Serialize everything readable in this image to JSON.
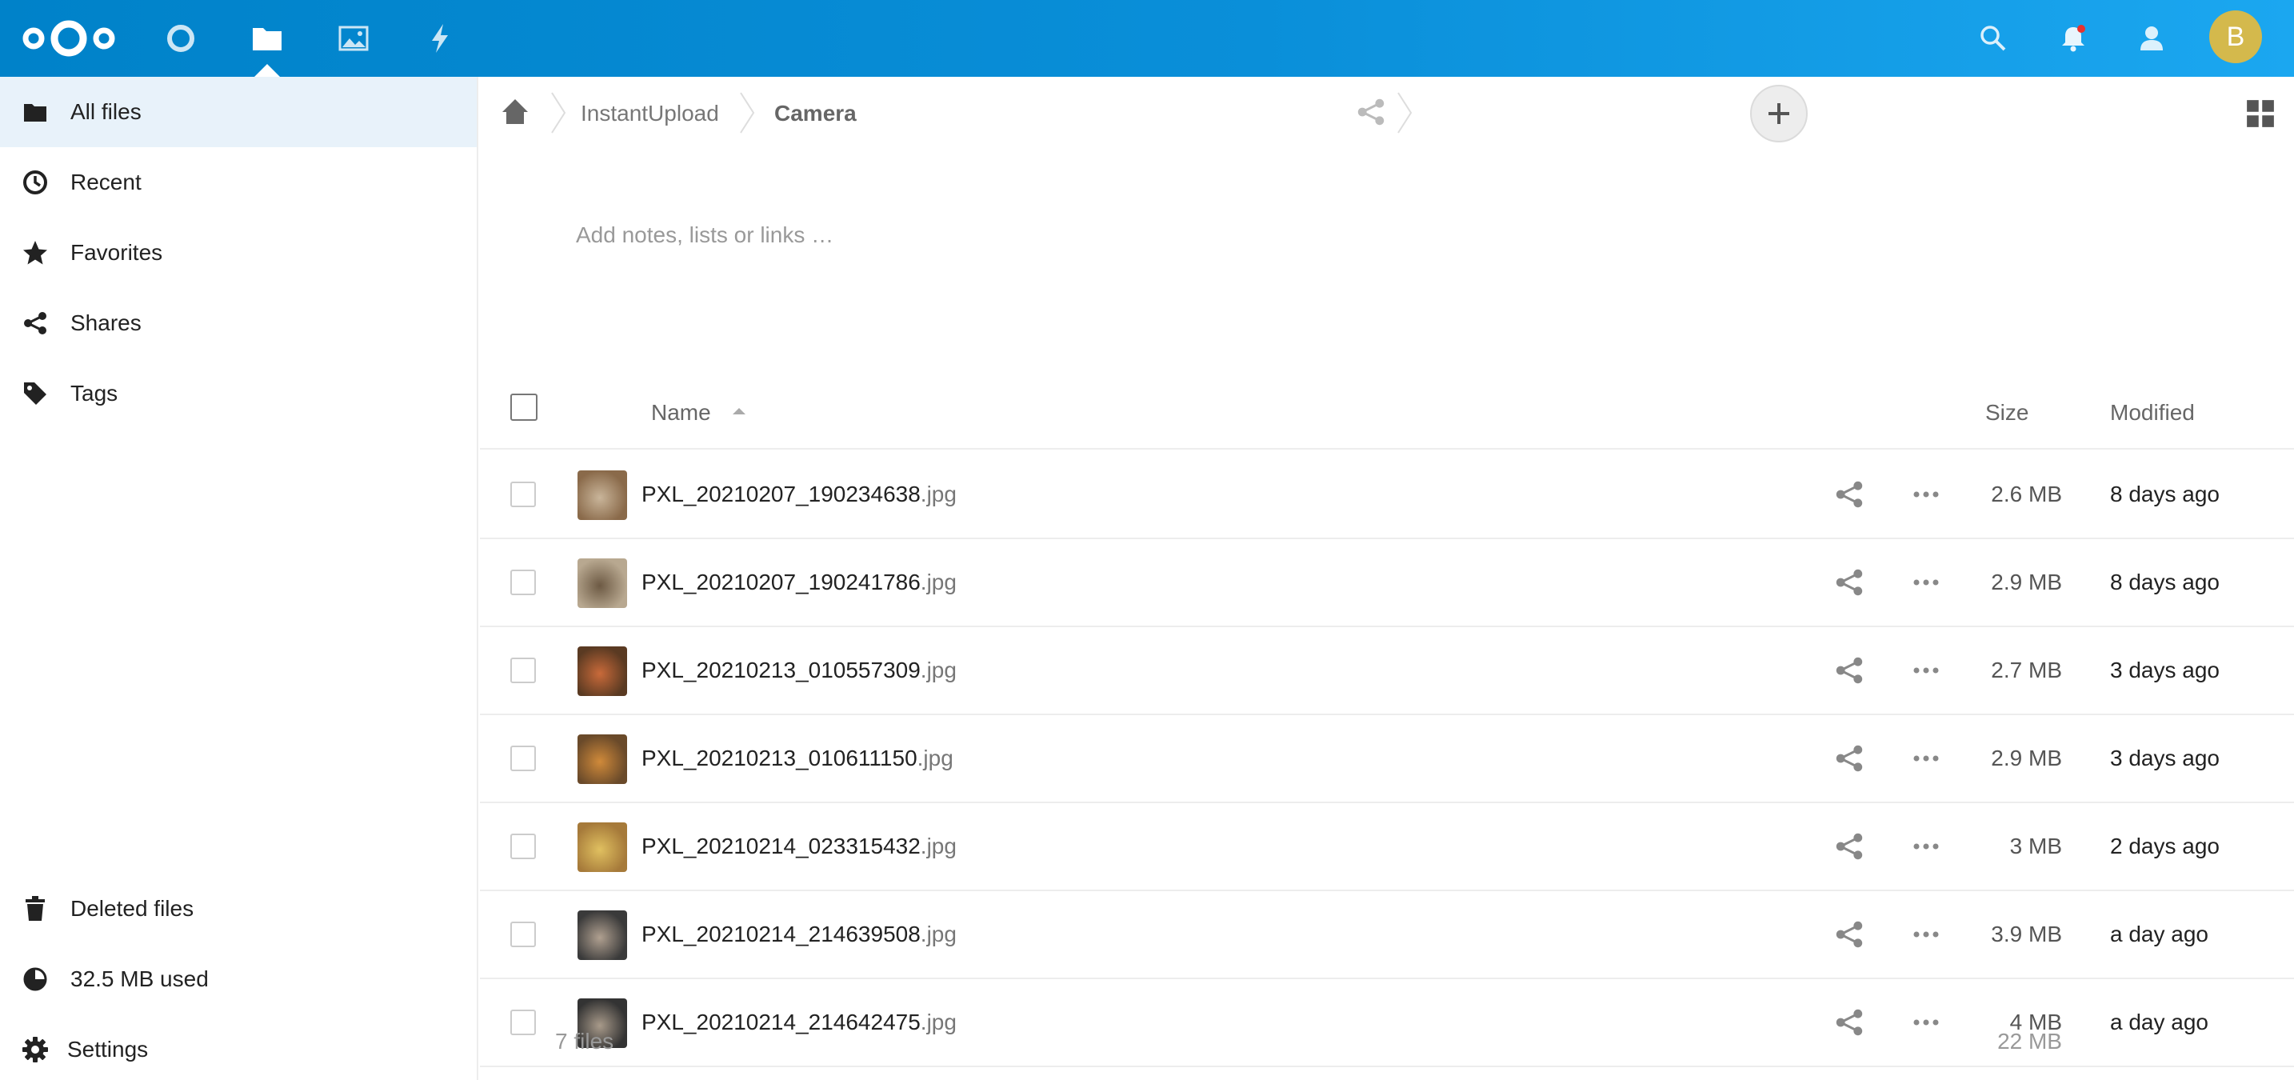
{
  "header": {
    "apps": [
      "dashboard",
      "files",
      "photos",
      "activity"
    ],
    "avatar_letter": "B"
  },
  "sidebar": {
    "items": [
      {
        "label": "All files",
        "icon": "folder-icon"
      },
      {
        "label": "Recent",
        "icon": "clock-icon"
      },
      {
        "label": "Favorites",
        "icon": "star-icon"
      },
      {
        "label": "Shares",
        "icon": "share-icon"
      },
      {
        "label": "Tags",
        "icon": "tag-icon"
      }
    ],
    "bottom": {
      "deleted": "Deleted files",
      "quota": "32.5 MB used",
      "settings": "Settings"
    }
  },
  "breadcrumb": {
    "items": [
      "InstantUpload",
      "Camera"
    ]
  },
  "notes_placeholder": "Add notes, lists or links …",
  "list": {
    "columns": {
      "name": "Name",
      "size": "Size",
      "modified": "Modified"
    },
    "files": [
      {
        "base": "PXL_20210207_190234638",
        "ext": ".jpg",
        "size": "2.6 MB",
        "modified": "8 days ago"
      },
      {
        "base": "PXL_20210207_190241786",
        "ext": ".jpg",
        "size": "2.9 MB",
        "modified": "8 days ago"
      },
      {
        "base": "PXL_20210213_010557309",
        "ext": ".jpg",
        "size": "2.7 MB",
        "modified": "3 days ago"
      },
      {
        "base": "PXL_20210213_010611150",
        "ext": ".jpg",
        "size": "2.9 MB",
        "modified": "3 days ago"
      },
      {
        "base": "PXL_20210214_023315432",
        "ext": ".jpg",
        "size": "3 MB",
        "modified": "2 days ago"
      },
      {
        "base": "PXL_20210214_214639508",
        "ext": ".jpg",
        "size": "3.9 MB",
        "modified": "a day ago"
      },
      {
        "base": "PXL_20210214_214642475",
        "ext": ".jpg",
        "size": "4 MB",
        "modified": "a day ago"
      }
    ],
    "summary": {
      "count": "7 files",
      "size": "22 MB"
    }
  },
  "colors": {
    "header_start": "#0082c9",
    "header_end": "#1ba7f0",
    "avatar": "#d4b94c",
    "active_nav": "#e8f2fa"
  }
}
